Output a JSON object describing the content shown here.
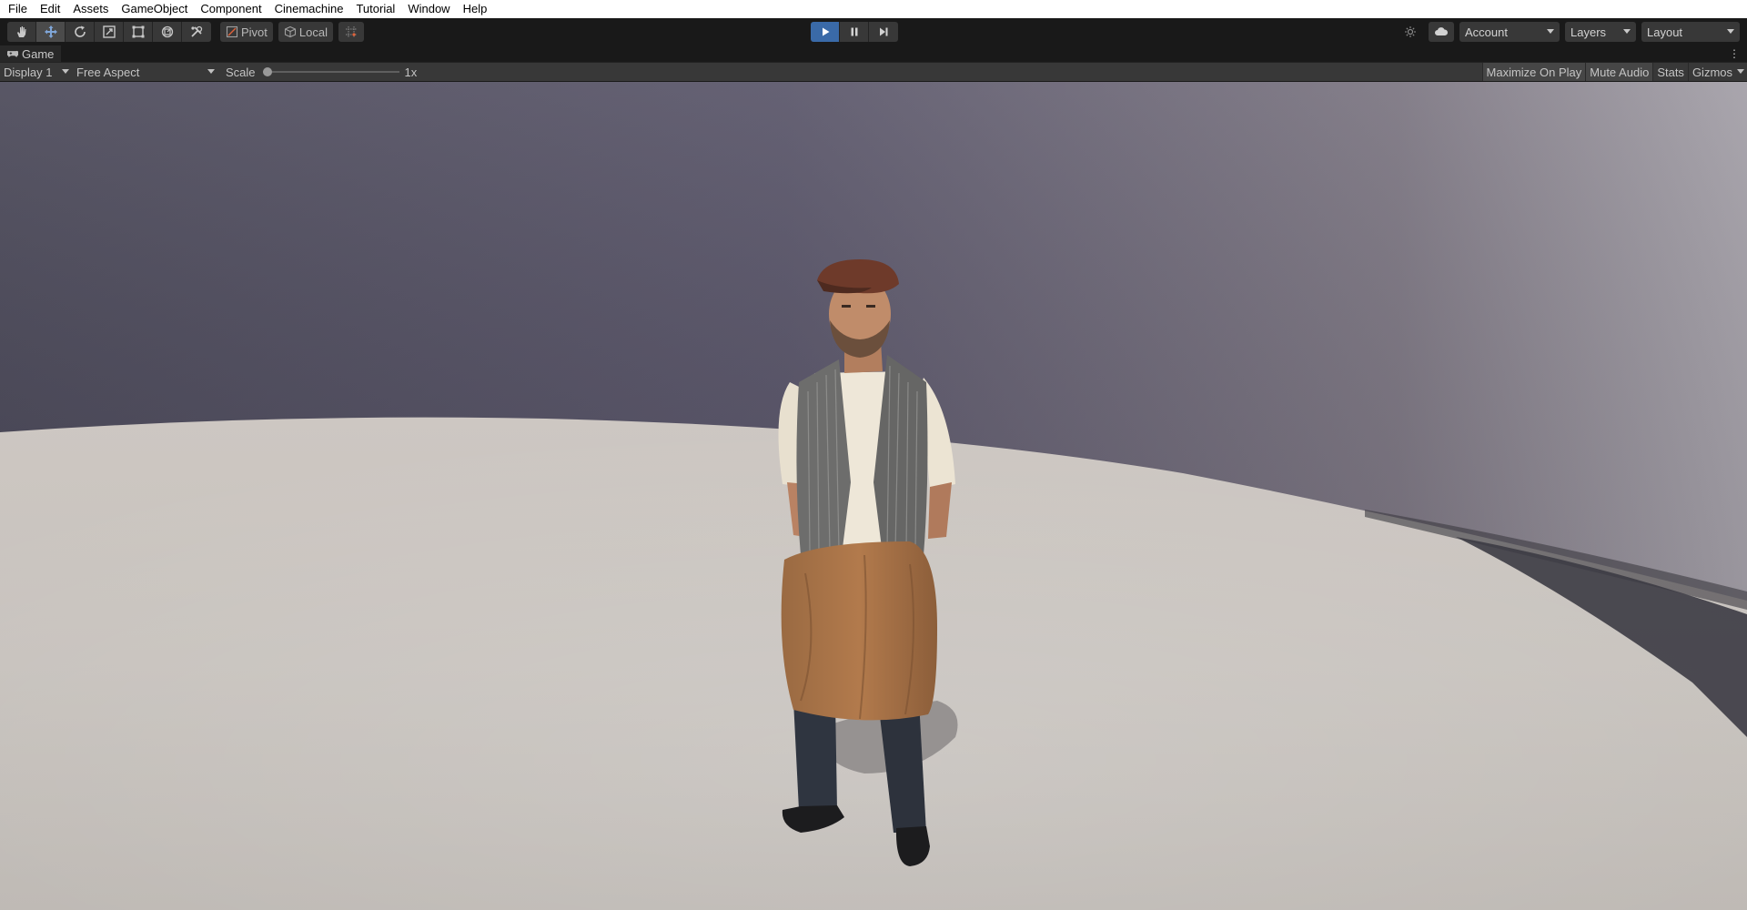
{
  "menu": [
    "File",
    "Edit",
    "Assets",
    "GameObject",
    "Component",
    "Cinemachine",
    "Tutorial",
    "Window",
    "Help"
  ],
  "toolbar": {
    "tools": [
      {
        "name": "hand-tool",
        "icon": "hand-icon",
        "active": false
      },
      {
        "name": "move-tool",
        "icon": "move-icon",
        "active": true
      },
      {
        "name": "rotate-tool",
        "icon": "rotate-icon",
        "active": false
      },
      {
        "name": "scale-tool",
        "icon": "scale-icon",
        "active": false
      },
      {
        "name": "rect-tool",
        "icon": "rect-icon",
        "active": false
      },
      {
        "name": "transform-tool",
        "icon": "transform-icon",
        "active": false
      },
      {
        "name": "custom-tool",
        "icon": "tools-icon",
        "active": false
      }
    ],
    "pivot_label": "Pivot",
    "local_label": "Local",
    "account_label": "Account",
    "layers_label": "Layers",
    "layout_label": "Layout",
    "play_accent": "#3a6aa8"
  },
  "game_view": {
    "tab_label": "Game",
    "display": "Display 1",
    "aspect": "Free Aspect",
    "scale_label": "Scale",
    "scale_value": "1x",
    "scale_fraction": 0.0,
    "maximize_on_play": "Maximize On Play",
    "mute_audio": "Mute Audio",
    "stats": "Stats",
    "gizmos": "Gizmos"
  }
}
